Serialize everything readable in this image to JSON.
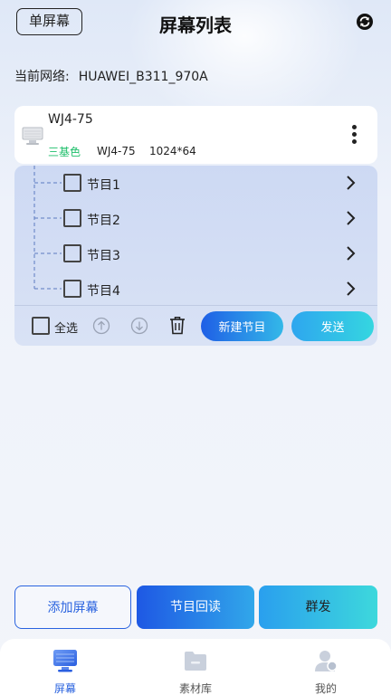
{
  "header": {
    "single_screen_label": "单屏幕",
    "title": "屏幕列表",
    "refresh_icon": "refresh-icon"
  },
  "network": {
    "label": "当前网络:",
    "ssid": "HUAWEI_B311_970A"
  },
  "device": {
    "name": "WJ4-75",
    "color_mode": "三基色",
    "model": "WJ4-75",
    "resolution": "1024*64",
    "colors": {
      "color_mode": "#1fbf6b"
    }
  },
  "programs": [
    {
      "label": "节目1"
    },
    {
      "label": "节目2"
    },
    {
      "label": "节目3"
    },
    {
      "label": "节目4"
    }
  ],
  "toolbar": {
    "select_all_label": "全选",
    "new_program_label": "新建节目",
    "send_label": "发送"
  },
  "actions": {
    "add_screen_label": "添加屏幕",
    "readback_label": "节目回读",
    "group_send_label": "群发"
  },
  "tabs": [
    {
      "label": "屏幕",
      "icon": "screen-icon",
      "active": true
    },
    {
      "label": "素材库",
      "icon": "folder-icon",
      "active": false
    },
    {
      "label": "我的",
      "icon": "user-icon",
      "active": false
    }
  ],
  "colors": {
    "accent": "#2a63df",
    "tab_active": "#2a63df",
    "tab_inactive": "#555555"
  }
}
